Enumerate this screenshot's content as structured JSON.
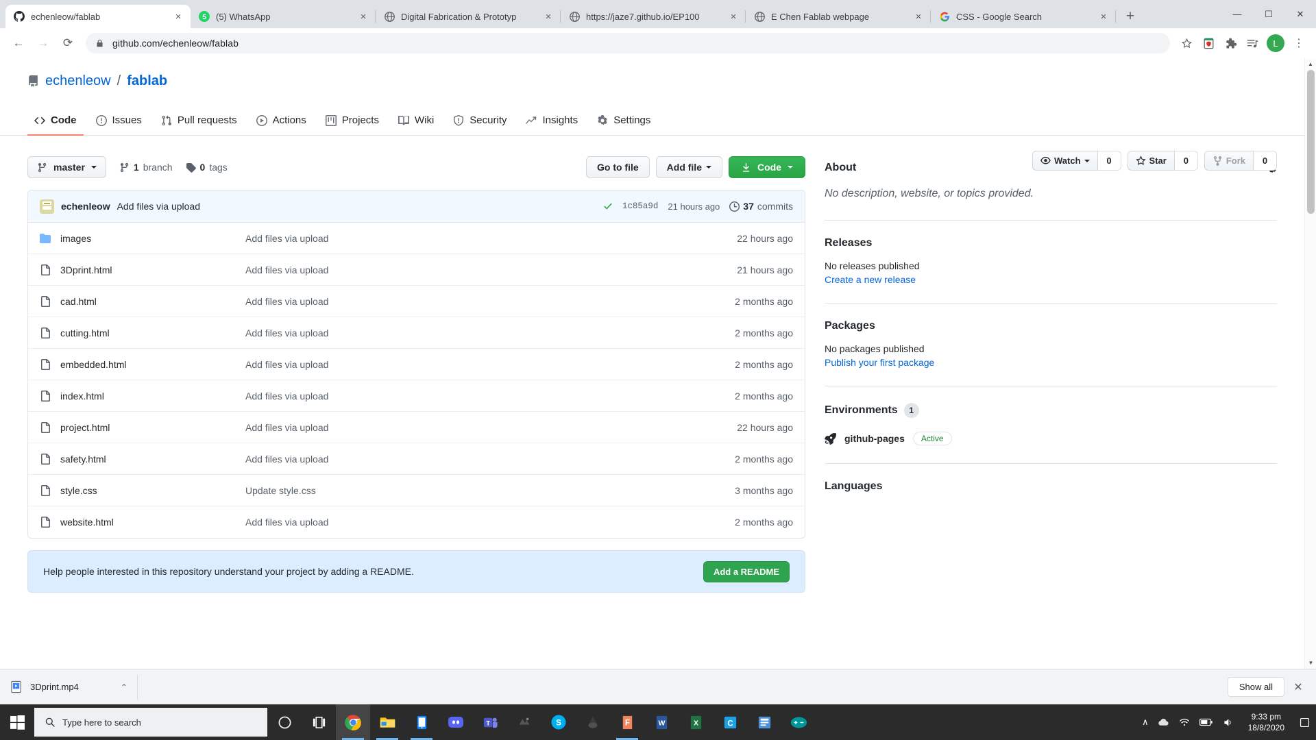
{
  "browser": {
    "tabs": [
      {
        "title": "echenleow/fablab",
        "favicon": "github-icon",
        "active": true
      },
      {
        "title": "(5) WhatsApp",
        "favicon": "whatsapp-icon",
        "active": false
      },
      {
        "title": "Digital Fabrication & Prototyp",
        "favicon": "globe-icon",
        "active": false
      },
      {
        "title": "https://jaze7.github.io/EP100",
        "favicon": "globe-icon",
        "active": false
      },
      {
        "title": "E Chen Fablab webpage",
        "favicon": "globe-icon",
        "active": false
      },
      {
        "title": "CSS - Google Search",
        "favicon": "google-icon",
        "active": false
      }
    ],
    "new_tab_label": "+",
    "tab_close_label": "×",
    "window_controls": {
      "minimize": "—",
      "maximize": "☐",
      "close": "✕"
    },
    "toolbar": {
      "back": "←",
      "forward": "→",
      "reload": "⟳",
      "url": "github.com/echenleow/fablab",
      "lock_icon": "lock-icon",
      "bookmark_icon": "star-icon",
      "extension_icons": [
        "shield-extension-icon",
        "puzzle-extension-icon",
        "playlist-extension-icon"
      ],
      "avatar_letter": "L",
      "menu": "⋮"
    }
  },
  "github": {
    "repo": {
      "owner": "echenleow",
      "separator": "/",
      "name": "fablab",
      "icon": "repo-icon"
    },
    "actions": [
      {
        "label": "Watch",
        "count": "0",
        "icon": "eye-icon",
        "has_caret": true,
        "muted": false
      },
      {
        "label": "Star",
        "count": "0",
        "icon": "star-icon",
        "has_caret": false,
        "muted": false
      },
      {
        "label": "Fork",
        "count": "0",
        "icon": "fork-icon",
        "has_caret": false,
        "muted": true
      }
    ],
    "nav": [
      {
        "label": "Code",
        "icon": "code-icon",
        "selected": true
      },
      {
        "label": "Issues",
        "icon": "issue-opened-icon",
        "selected": false
      },
      {
        "label": "Pull requests",
        "icon": "git-pull-request-icon",
        "selected": false
      },
      {
        "label": "Actions",
        "icon": "play-icon",
        "selected": false
      },
      {
        "label": "Projects",
        "icon": "project-board-icon",
        "selected": false
      },
      {
        "label": "Wiki",
        "icon": "book-icon",
        "selected": false
      },
      {
        "label": "Security",
        "icon": "shield-icon",
        "selected": false
      },
      {
        "label": "Insights",
        "icon": "graph-icon",
        "selected": false
      },
      {
        "label": "Settings",
        "icon": "gear-icon",
        "selected": false
      }
    ],
    "file_header": {
      "branch": "master",
      "branch_icon": "git-branch-icon",
      "branch_count": "1",
      "branch_count_label": "branch",
      "tag_count": "0",
      "tag_count_label": "tags",
      "tag_icon": "tag-icon",
      "go_to_file": "Go to file",
      "add_file": "Add file",
      "code": "Code",
      "code_icon": "download-icon"
    },
    "latest_commit": {
      "author": "echenleow",
      "message": "Add files via upload",
      "status_icon": "check-icon",
      "sha": "1c85a9d",
      "time": "21 hours ago",
      "commits_count": "37",
      "commits_label": "commits",
      "history_icon": "history-icon"
    },
    "files": [
      {
        "name": "images",
        "type": "dir",
        "message": "Add files via upload",
        "time": "22 hours ago"
      },
      {
        "name": "3Dprint.html",
        "type": "file",
        "message": "Add files via upload",
        "time": "21 hours ago"
      },
      {
        "name": "cad.html",
        "type": "file",
        "message": "Add files via upload",
        "time": "2 months ago"
      },
      {
        "name": "cutting.html",
        "type": "file",
        "message": "Add files via upload",
        "time": "2 months ago"
      },
      {
        "name": "embedded.html",
        "type": "file",
        "message": "Add files via upload",
        "time": "2 months ago"
      },
      {
        "name": "index.html",
        "type": "file",
        "message": "Add files via upload",
        "time": "2 months ago"
      },
      {
        "name": "project.html",
        "type": "file",
        "message": "Add files via upload",
        "time": "22 hours ago"
      },
      {
        "name": "safety.html",
        "type": "file",
        "message": "Add files via upload",
        "time": "2 months ago"
      },
      {
        "name": "style.css",
        "type": "file",
        "message": "Update style.css",
        "time": "3 months ago"
      },
      {
        "name": "website.html",
        "type": "file",
        "message": "Add files via upload",
        "time": "2 months ago"
      }
    ],
    "readme_banner": {
      "text": "Help people interested in this repository understand your project by adding a README.",
      "button": "Add a README"
    },
    "sidebar": {
      "about_title": "About",
      "about_gear_icon": "gear-icon",
      "about_description": "No description, website, or topics provided.",
      "releases_title": "Releases",
      "releases_text": "No releases published",
      "releases_link": "Create a new release",
      "packages_title": "Packages",
      "packages_text": "No packages published",
      "packages_link": "Publish your first package",
      "environments_title": "Environments",
      "environments_count": "1",
      "environment_name": "github-pages",
      "environment_icon": "rocket-icon",
      "environment_status": "Active",
      "languages_title": "Languages"
    }
  },
  "download_bar": {
    "file_name": "3Dprint.mp4",
    "file_icon": "video-file-icon",
    "chevron": "⌃",
    "show_all": "Show all",
    "close": "✕"
  },
  "taskbar": {
    "start_icon": "windows-icon",
    "search_placeholder": "Type here to search",
    "search_icon": "search-icon",
    "items": [
      {
        "name": "cortana-icon"
      },
      {
        "name": "task-view-icon"
      },
      {
        "name": "chrome-icon"
      },
      {
        "name": "file-explorer-icon"
      },
      {
        "name": "phone-link-icon"
      },
      {
        "name": "discord-icon"
      },
      {
        "name": "teams-icon"
      },
      {
        "name": "fusion360-icon"
      },
      {
        "name": "skype-icon"
      },
      {
        "name": "blender-icon"
      },
      {
        "name": "fritzing-icon"
      },
      {
        "name": "word-icon"
      },
      {
        "name": "excel-icon"
      },
      {
        "name": "cura-icon"
      },
      {
        "name": "sticky-notes-icon"
      },
      {
        "name": "arduino-icon"
      }
    ],
    "tray": {
      "chevron_up": "∧",
      "onedrive_icon": "cloud-icon",
      "network_icon": "wifi-icon",
      "battery_icon": "battery-icon",
      "volume_icon": "volume-icon",
      "time": "9:33 pm",
      "date": "18/8/2020",
      "action_center_icon": "notification-icon"
    }
  },
  "colors": {
    "accent_blue": "#0366d6",
    "green": "#2ea44f",
    "orange_underline": "#f9826c",
    "info_bg": "#dbedff",
    "commit_bg": "#f1f8ff"
  }
}
